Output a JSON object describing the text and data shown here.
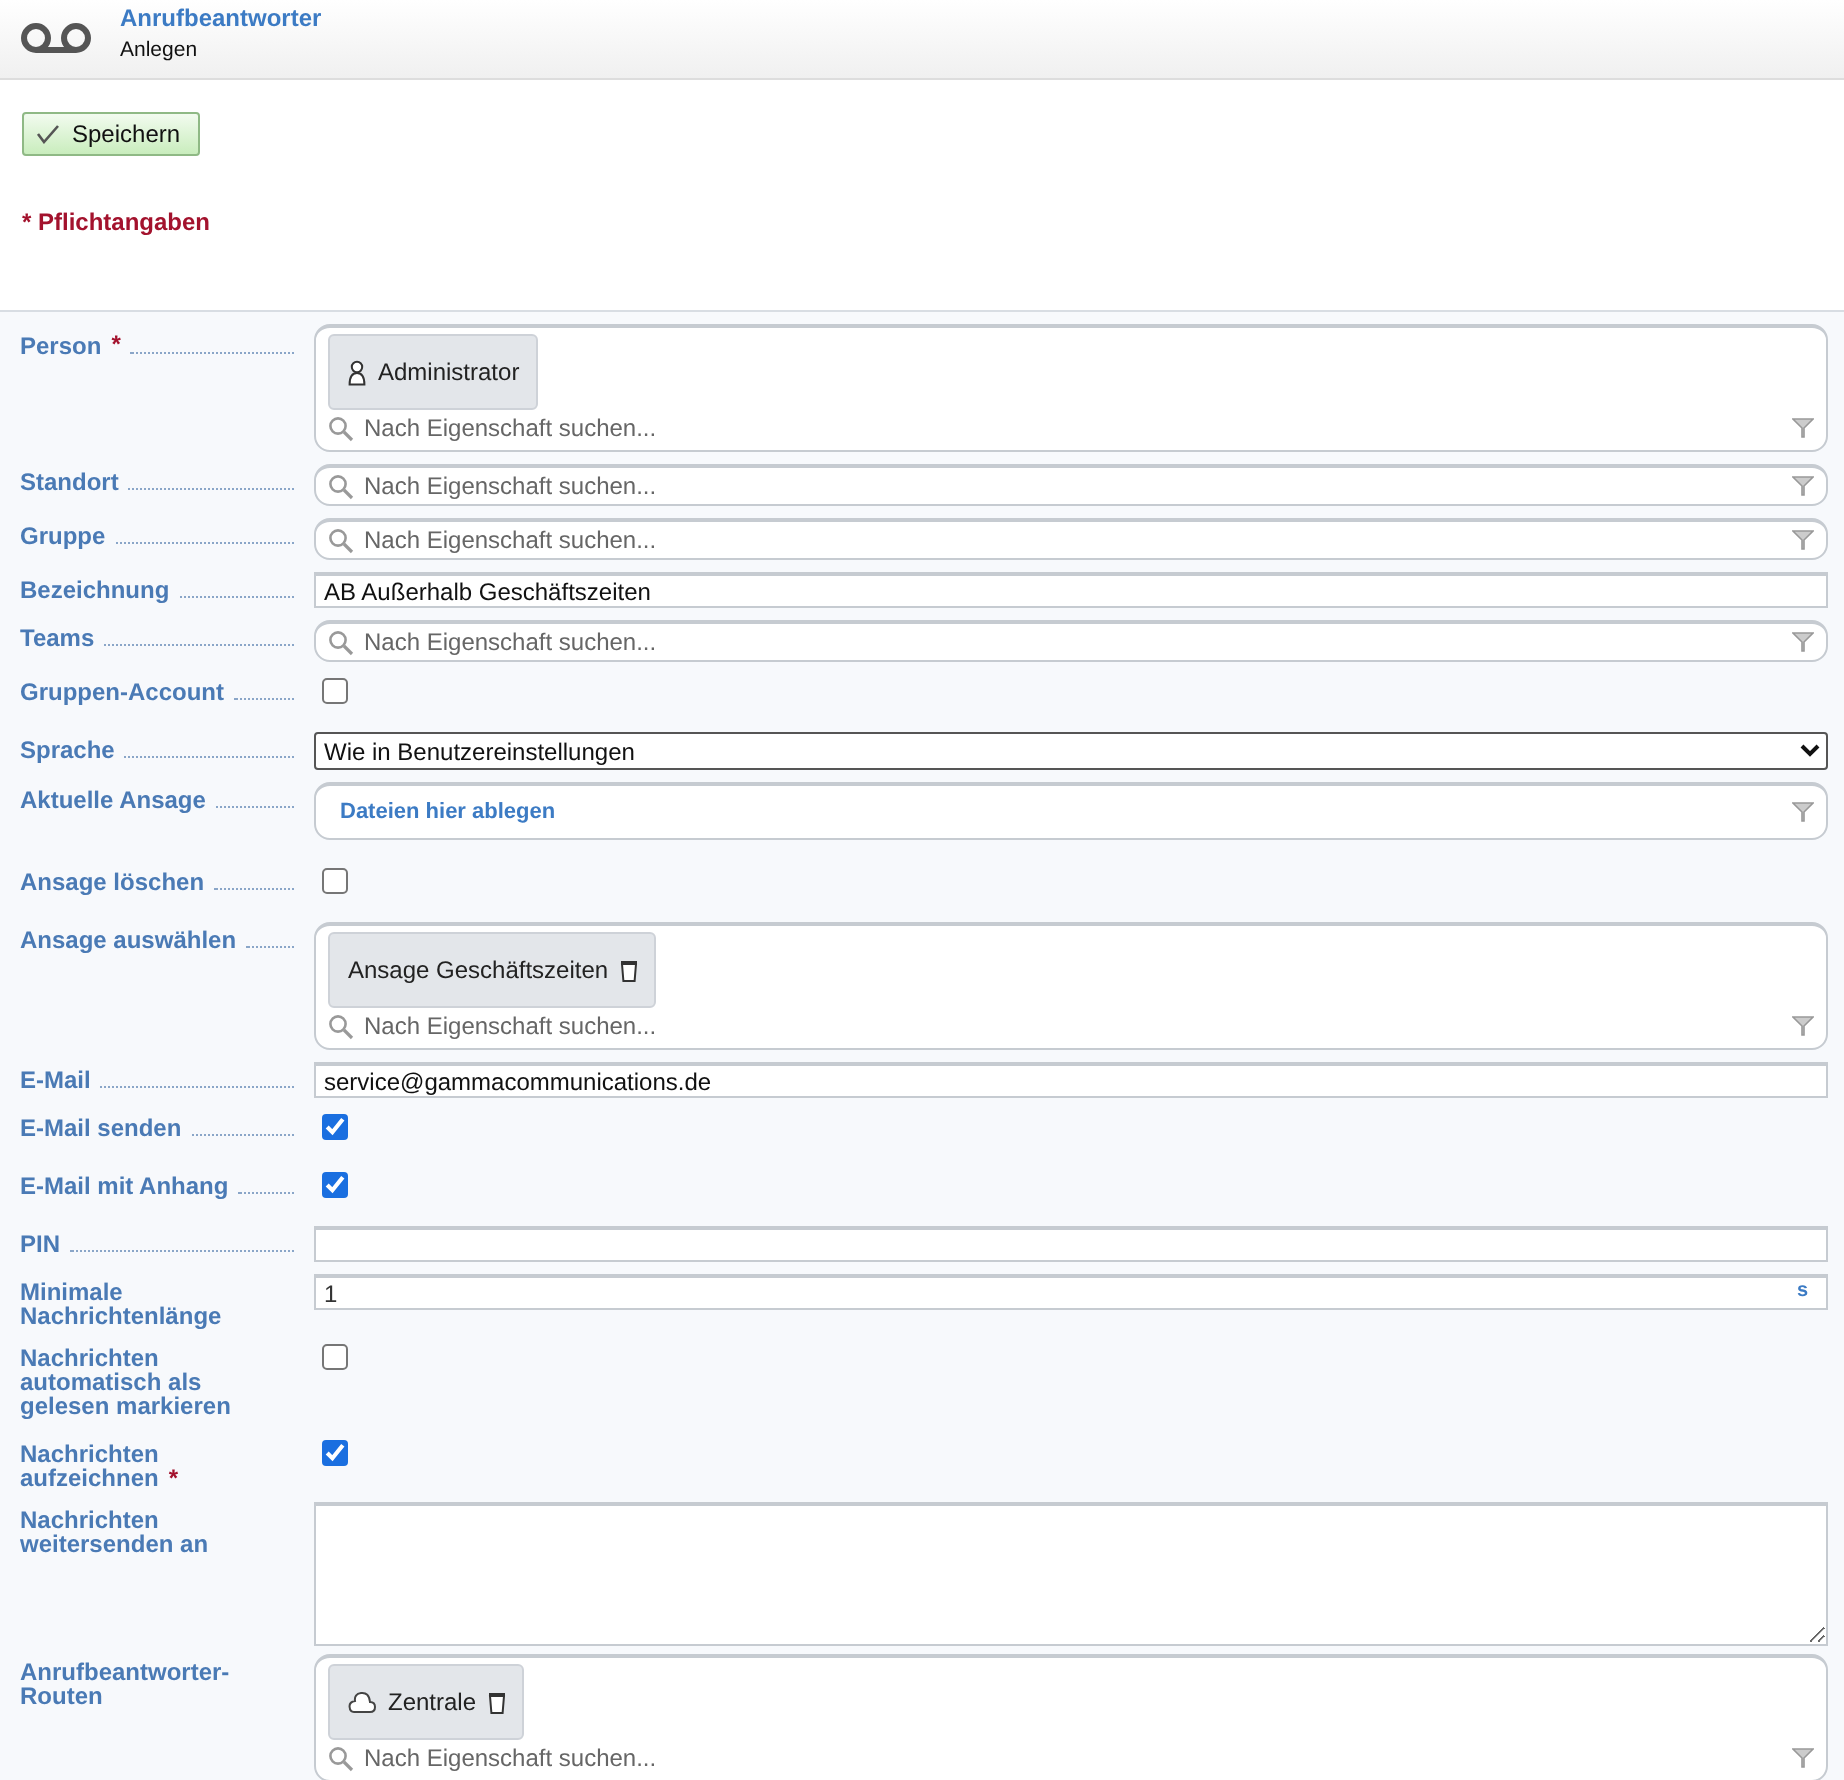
{
  "header": {
    "title": "Anrufbeantworter",
    "subtitle": "Anlegen"
  },
  "toolbar": {
    "save_button": "Speichern"
  },
  "required_note": "* Pflichtangaben",
  "fields": [
    {
      "label": "Person",
      "required_mark": "*",
      "kind": "tagsearch",
      "tags": [
        {
          "label": "Administrator",
          "kind": "person",
          "removable": false
        }
      ],
      "placeholder": "Nach Eigenschaft suchen..."
    },
    {
      "label": "Standort",
      "kind": "tagsearch",
      "placeholder": "Nach Eigenschaft suchen..."
    },
    {
      "label": "Gruppe",
      "kind": "tagsearch",
      "placeholder": "Nach Eigenschaft suchen..."
    },
    {
      "label": "Bezeichnung",
      "kind": "text",
      "value": "AB Außerhalb Geschäftszeiten"
    },
    {
      "label": "Teams",
      "kind": "tagsearch",
      "placeholder": "Nach Eigenschaft suchen..."
    },
    {
      "label": "Gruppen-Account",
      "kind": "checkbox",
      "checked": false
    },
    {
      "label": "Sprache",
      "kind": "select",
      "value": "Wie in Benutzereinstellungen"
    },
    {
      "label": "Aktuelle Ansage",
      "kind": "dropzone",
      "hint": "Dateien hier ablegen"
    },
    {
      "label": "Ansage löschen",
      "kind": "checkbox",
      "checked": false
    },
    {
      "label": "Ansage auswählen",
      "kind": "tagsearch",
      "tags": [
        {
          "label": "Ansage Geschäftszeiten",
          "kind": "plain",
          "removable": true
        }
      ],
      "placeholder": "Nach Eigenschaft suchen..."
    },
    {
      "label": "E-Mail",
      "kind": "text",
      "value": "service@gammacommunications.de"
    },
    {
      "label": "E-Mail senden",
      "kind": "checkbox",
      "checked": true
    },
    {
      "label": "E-Mail mit Anhang",
      "kind": "checkbox",
      "checked": true
    },
    {
      "label": "PIN",
      "kind": "text"
    },
    {
      "label": "Minimale Nachrichtenlänge",
      "kind": "unit",
      "value": "1",
      "unit": "s"
    },
    {
      "label": "Nachrichten automatisch als gelesen markieren",
      "kind": "checkbox",
      "checked": false
    },
    {
      "label": "Nachrichten aufzeichnen",
      "required_mark": "*",
      "kind": "checkbox",
      "checked": true
    },
    {
      "label": "Nachrichten weitersenden an",
      "kind": "textarea"
    },
    {
      "label": "Anrufbeantworter-Routen",
      "kind": "tagsearch",
      "tags": [
        {
          "label": "Zentrale",
          "kind": "route",
          "removable": true
        }
      ],
      "placeholder": "Nach Eigenschaft suchen..."
    }
  ]
}
